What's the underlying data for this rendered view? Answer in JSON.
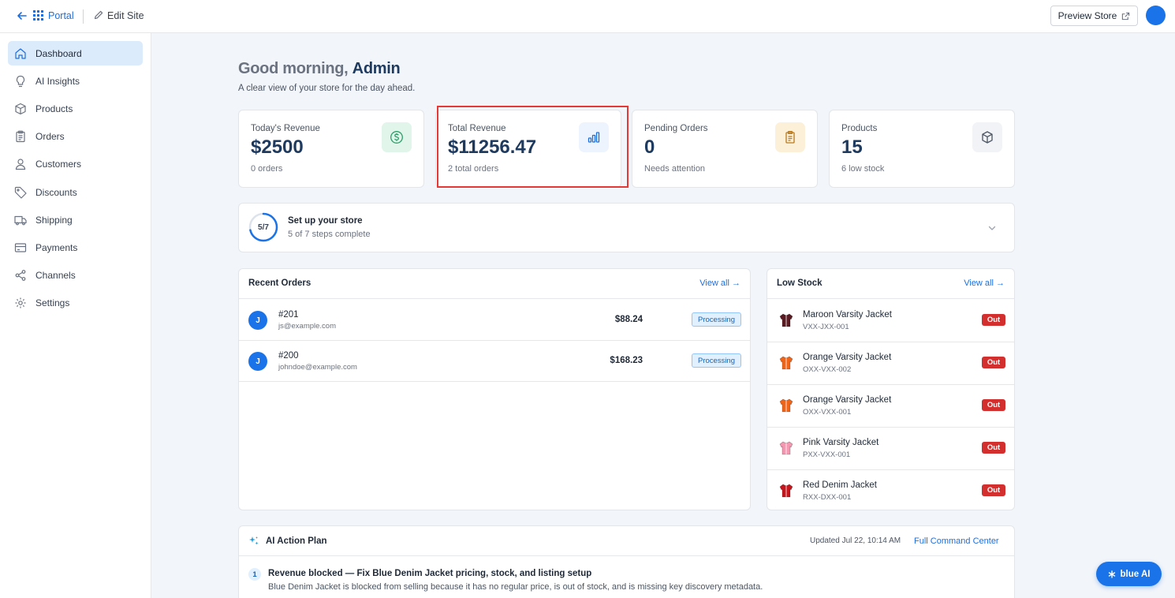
{
  "topbar": {
    "portal_label": "Portal",
    "edit_label": "Edit Site",
    "preview_label": "Preview Store"
  },
  "sidebar": {
    "items": [
      {
        "label": "Dashboard",
        "icon": "home-icon",
        "active": true
      },
      {
        "label": "AI Insights",
        "icon": "lightbulb-icon"
      },
      {
        "label": "Products",
        "icon": "box-icon"
      },
      {
        "label": "Orders",
        "icon": "clipboard-icon"
      },
      {
        "label": "Customers",
        "icon": "user-icon"
      },
      {
        "label": "Discounts",
        "icon": "tag-icon"
      },
      {
        "label": "Shipping",
        "icon": "truck-icon"
      },
      {
        "label": "Payments",
        "icon": "credit-card-icon"
      },
      {
        "label": "Channels",
        "icon": "share-icon"
      },
      {
        "label": "Settings",
        "icon": "gear-icon"
      }
    ]
  },
  "greeting": {
    "prefix": "Good morning, ",
    "name": "Admin",
    "subtitle": "A clear view of your store for the day ahead."
  },
  "stats": [
    {
      "label": "Today's Revenue",
      "value": "$2500",
      "sub": "0 orders",
      "icon": "dollar-icon",
      "color": "#2e9e6a"
    },
    {
      "label": "Total Revenue",
      "value": "$11256.47",
      "sub": "2 total orders",
      "icon": "bar-chart-icon",
      "color": "#1d6fe0"
    },
    {
      "label": "Pending Orders",
      "value": "0",
      "sub": "Needs attention",
      "icon": "clipboard-icon",
      "color": "#b7791f"
    },
    {
      "label": "Products",
      "value": "15",
      "sub": "6 low stock",
      "icon": "box-icon",
      "color": "#4b5563"
    }
  ],
  "setup": {
    "ring_label": "5/7",
    "progress": 0.714,
    "title": "Set up your store",
    "subtitle": "5 of 7 steps complete"
  },
  "recent_orders": {
    "title": "Recent Orders",
    "view_all": "View all →",
    "rows": [
      {
        "initial": "J",
        "id": "#201",
        "email": "js@example.com",
        "amount": "$88.24",
        "status": "Processing"
      },
      {
        "initial": "J",
        "id": "#200",
        "email": "johndoe@example.com",
        "amount": "$168.23",
        "status": "Processing"
      }
    ]
  },
  "low_stock": {
    "title": "Low Stock",
    "view_all": "View all →",
    "rows": [
      {
        "name": "Maroon Varsity Jacket",
        "sku": "VXX-JXX-001",
        "badge": "Out",
        "color": "#5a1a22"
      },
      {
        "name": "Orange Varsity Jacket",
        "sku": "OXX-VXX-002",
        "badge": "Out",
        "color": "#f06418"
      },
      {
        "name": "Orange Varsity Jacket",
        "sku": "OXX-VXX-001",
        "badge": "Out",
        "color": "#f06418"
      },
      {
        "name": "Pink Varsity Jacket",
        "sku": "PXX-VXX-001",
        "badge": "Out",
        "color": "#f497b0"
      },
      {
        "name": "Red Denim Jacket",
        "sku": "RXX-DXX-001",
        "badge": "Out",
        "color": "#c4161c"
      }
    ]
  },
  "action_plan": {
    "title": "AI Action Plan",
    "updated": "Updated Jul 22, 10:14 AM",
    "link": "Full Command Center",
    "items": [
      {
        "num": "1",
        "title": "Revenue blocked — Fix Blue Denim Jacket pricing, stock, and listing setup",
        "desc": "Blue Denim Jacket is blocked from selling because it has no regular price, is out of stock, and is missing key discovery metadata."
      }
    ]
  },
  "ai_button": {
    "label": "blue AI"
  }
}
